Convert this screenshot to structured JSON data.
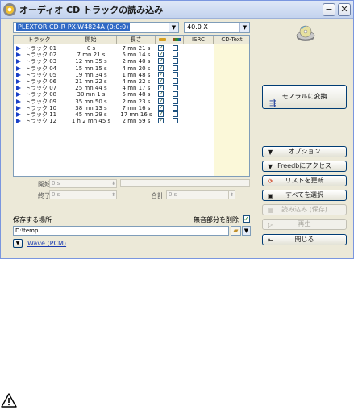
{
  "window": {
    "title": "オーディオ CD トラックの読み込み",
    "min_glyph": "−",
    "close_glyph": "✕"
  },
  "drive": {
    "selected": "PLEXTOR  CD-R   PX-W4824A (0:0:0)"
  },
  "speed": {
    "selected": "40.0 X"
  },
  "columns": [
    "トラック",
    "開始",
    "長さ",
    "",
    "",
    "ISRC",
    "CD-Text"
  ],
  "tracks": [
    {
      "name": "トラック 01",
      "start": "0 s",
      "length": "7 mn 21 s",
      "sel": true,
      "ex": false
    },
    {
      "name": "トラック 02",
      "start": "7 mn 21 s",
      "length": "5 mn 14 s",
      "sel": true,
      "ex": false
    },
    {
      "name": "トラック 03",
      "start": "12 mn 35 s",
      "length": "2 mn 40 s",
      "sel": true,
      "ex": false
    },
    {
      "name": "トラック 04",
      "start": "15 mn 15 s",
      "length": "4 mn 20 s",
      "sel": true,
      "ex": false
    },
    {
      "name": "トラック 05",
      "start": "19 mn 34 s",
      "length": "1 mn 48 s",
      "sel": true,
      "ex": false
    },
    {
      "name": "トラック 06",
      "start": "21 mn 22 s",
      "length": "4 mn 22 s",
      "sel": true,
      "ex": false
    },
    {
      "name": "トラック 07",
      "start": "25 mn 44 s",
      "length": "4 mn 17 s",
      "sel": true,
      "ex": false
    },
    {
      "name": "トラック 08",
      "start": "30 mn 1 s",
      "length": "5 mn 48 s",
      "sel": true,
      "ex": false
    },
    {
      "name": "トラック 09",
      "start": "35 mn 50 s",
      "length": "2 mn 23 s",
      "sel": true,
      "ex": false
    },
    {
      "name": "トラック 10",
      "start": "38 mn 13 s",
      "length": "7 mn 16 s",
      "sel": true,
      "ex": false
    },
    {
      "name": "トラック 11",
      "start": "45 mn 29 s",
      "length": "17 mn 16 s",
      "sel": true,
      "ex": false
    },
    {
      "name": "トラック 12",
      "start": "1 h 2 mn 45 s",
      "length": "2 mn 59 s",
      "sel": true,
      "ex": false
    }
  ],
  "range": {
    "start_label": "開始",
    "start_value": "0 s",
    "end_label": "終了",
    "end_value": "0 s",
    "total_label": "合計",
    "total_value": "0 s"
  },
  "save": {
    "label": "保存する場所",
    "path": "D:\\temp",
    "delete_label": "無音部分を削除",
    "delete_checked": true
  },
  "format": {
    "link": "Wave (PCM)"
  },
  "buttons": {
    "convert": "モノラルに変換",
    "options": "オプション",
    "freedb": "Freedbにアクセス",
    "refresh": "リストを更新",
    "select_all": "すべてを選択",
    "read_save": "読み込み (保存)",
    "play": "再生",
    "close": "閉じる"
  },
  "icons": [
    "app-cd-icon",
    "cd-drive-icon",
    "folder-icon",
    "warning-icon"
  ]
}
